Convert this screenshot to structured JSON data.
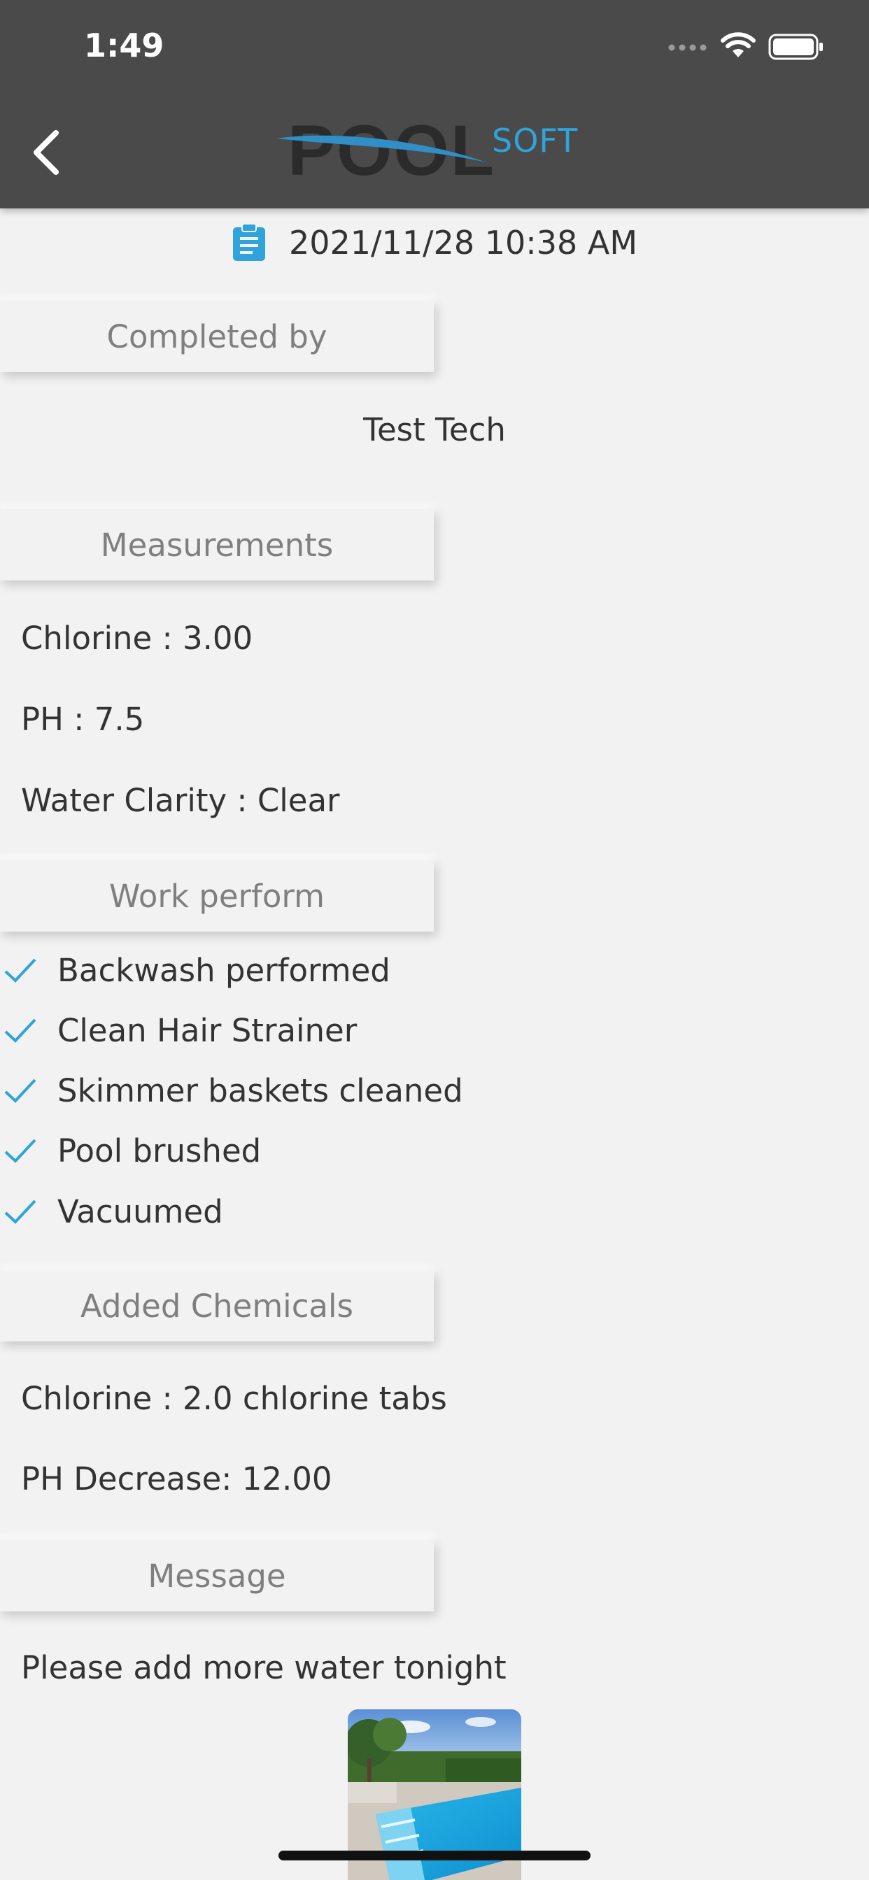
{
  "status_bar": {
    "time": "1:49"
  },
  "header": {
    "logo_text": "POOL",
    "logo_accent": "SOFT"
  },
  "report": {
    "date": "2021/11/28 10:38 AM",
    "completed_by_title": "Completed by",
    "technician": "Test Tech",
    "measurements_title": "Measurements",
    "measurements": [
      "Chlorine : 3.00",
      "PH : 7.5",
      "Water Clarity : Clear"
    ],
    "work_title": "Work perform",
    "work_items": [
      "Backwash performed",
      "Clean Hair Strainer",
      "Skimmer baskets cleaned",
      "Pool brushed",
      "Vacuumed"
    ],
    "chemicals_title": "Added Chemicals",
    "chemicals": [
      "Chlorine : 2.0 chlorine tabs",
      "PH Decrease: 12.00"
    ],
    "message_title": "Message",
    "message": "Please add more water tonight"
  },
  "colors": {
    "header_bg": "#4a4a4a",
    "accent": "#2fa3da",
    "background": "#f2f2f2"
  }
}
